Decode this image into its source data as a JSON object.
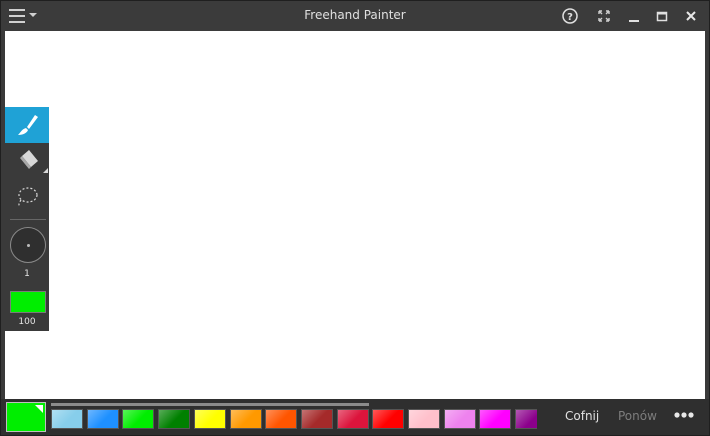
{
  "app": {
    "title": "Freehand Painter"
  },
  "tools": {
    "brush_size_label": "1",
    "opacity_label": "100",
    "current_color": "#00ee00"
  },
  "palette": {
    "colors": [
      "#87ceeb",
      "#1e90ff",
      "#00ee00",
      "#008000",
      "#ffff00",
      "#ff9900",
      "#ff5500",
      "#a52a2a",
      "#dc143c",
      "#ff0000",
      "#ffc0cb",
      "#ee82ee",
      "#ff00ff",
      "#8b008b"
    ]
  },
  "actions": {
    "undo_label": "Cofnij",
    "redo_label": "Ponów"
  },
  "colors": {
    "accent": "#1fa2d6",
    "panel": "#3a3a3a"
  }
}
